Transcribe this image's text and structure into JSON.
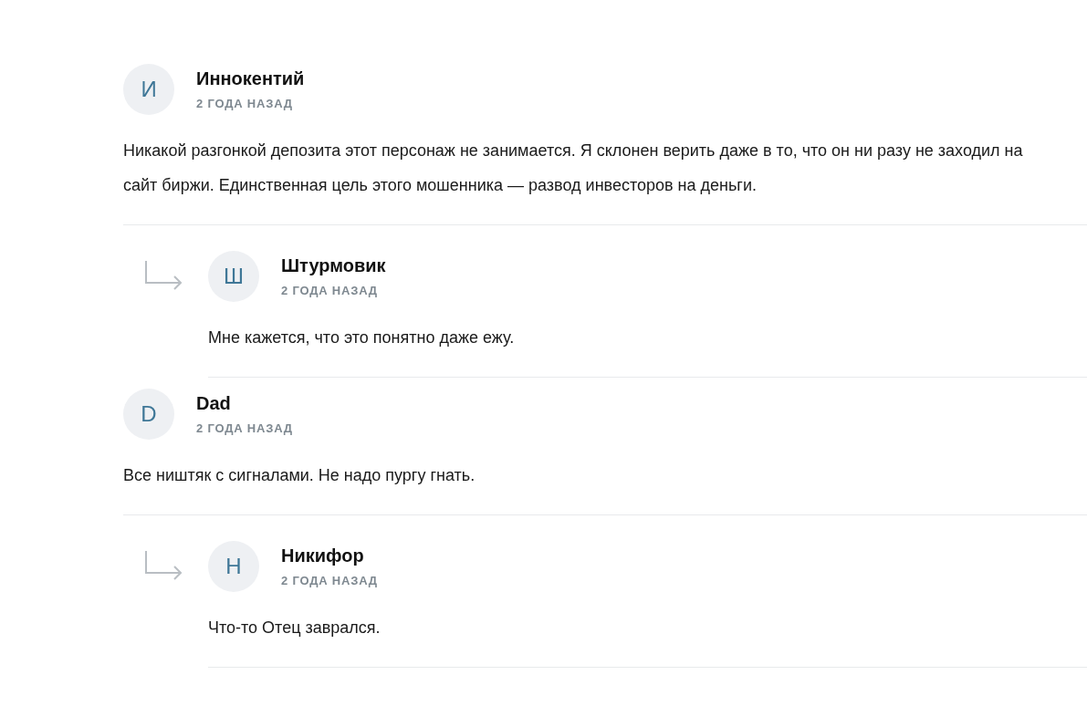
{
  "comments": [
    {
      "initial": "И",
      "author": "Иннокентий",
      "time": "2 ГОДА НАЗАД",
      "text": "Никакой разгонкой депозита этот персонаж не занимается. Я склонен верить даже в то, что он ни разу не заходил на сайт биржи. Единственная цель этого мошенника — развод инвесторов на деньги.",
      "replies": [
        {
          "initial": "Ш",
          "author": "Штурмовик",
          "time": "2 ГОДА НАЗАД",
          "text": "Мне кажется, что это понятно даже ежу."
        }
      ]
    },
    {
      "initial": "D",
      "author": "Dad",
      "time": "2 ГОДА НАЗАД",
      "text": "Все ништяк с сигналами. Не надо пургу гнать.",
      "replies": [
        {
          "initial": "Н",
          "author": "Никифор",
          "time": "2 ГОДА НАЗАД",
          "text": "Что-то Отец заврался."
        }
      ]
    }
  ]
}
